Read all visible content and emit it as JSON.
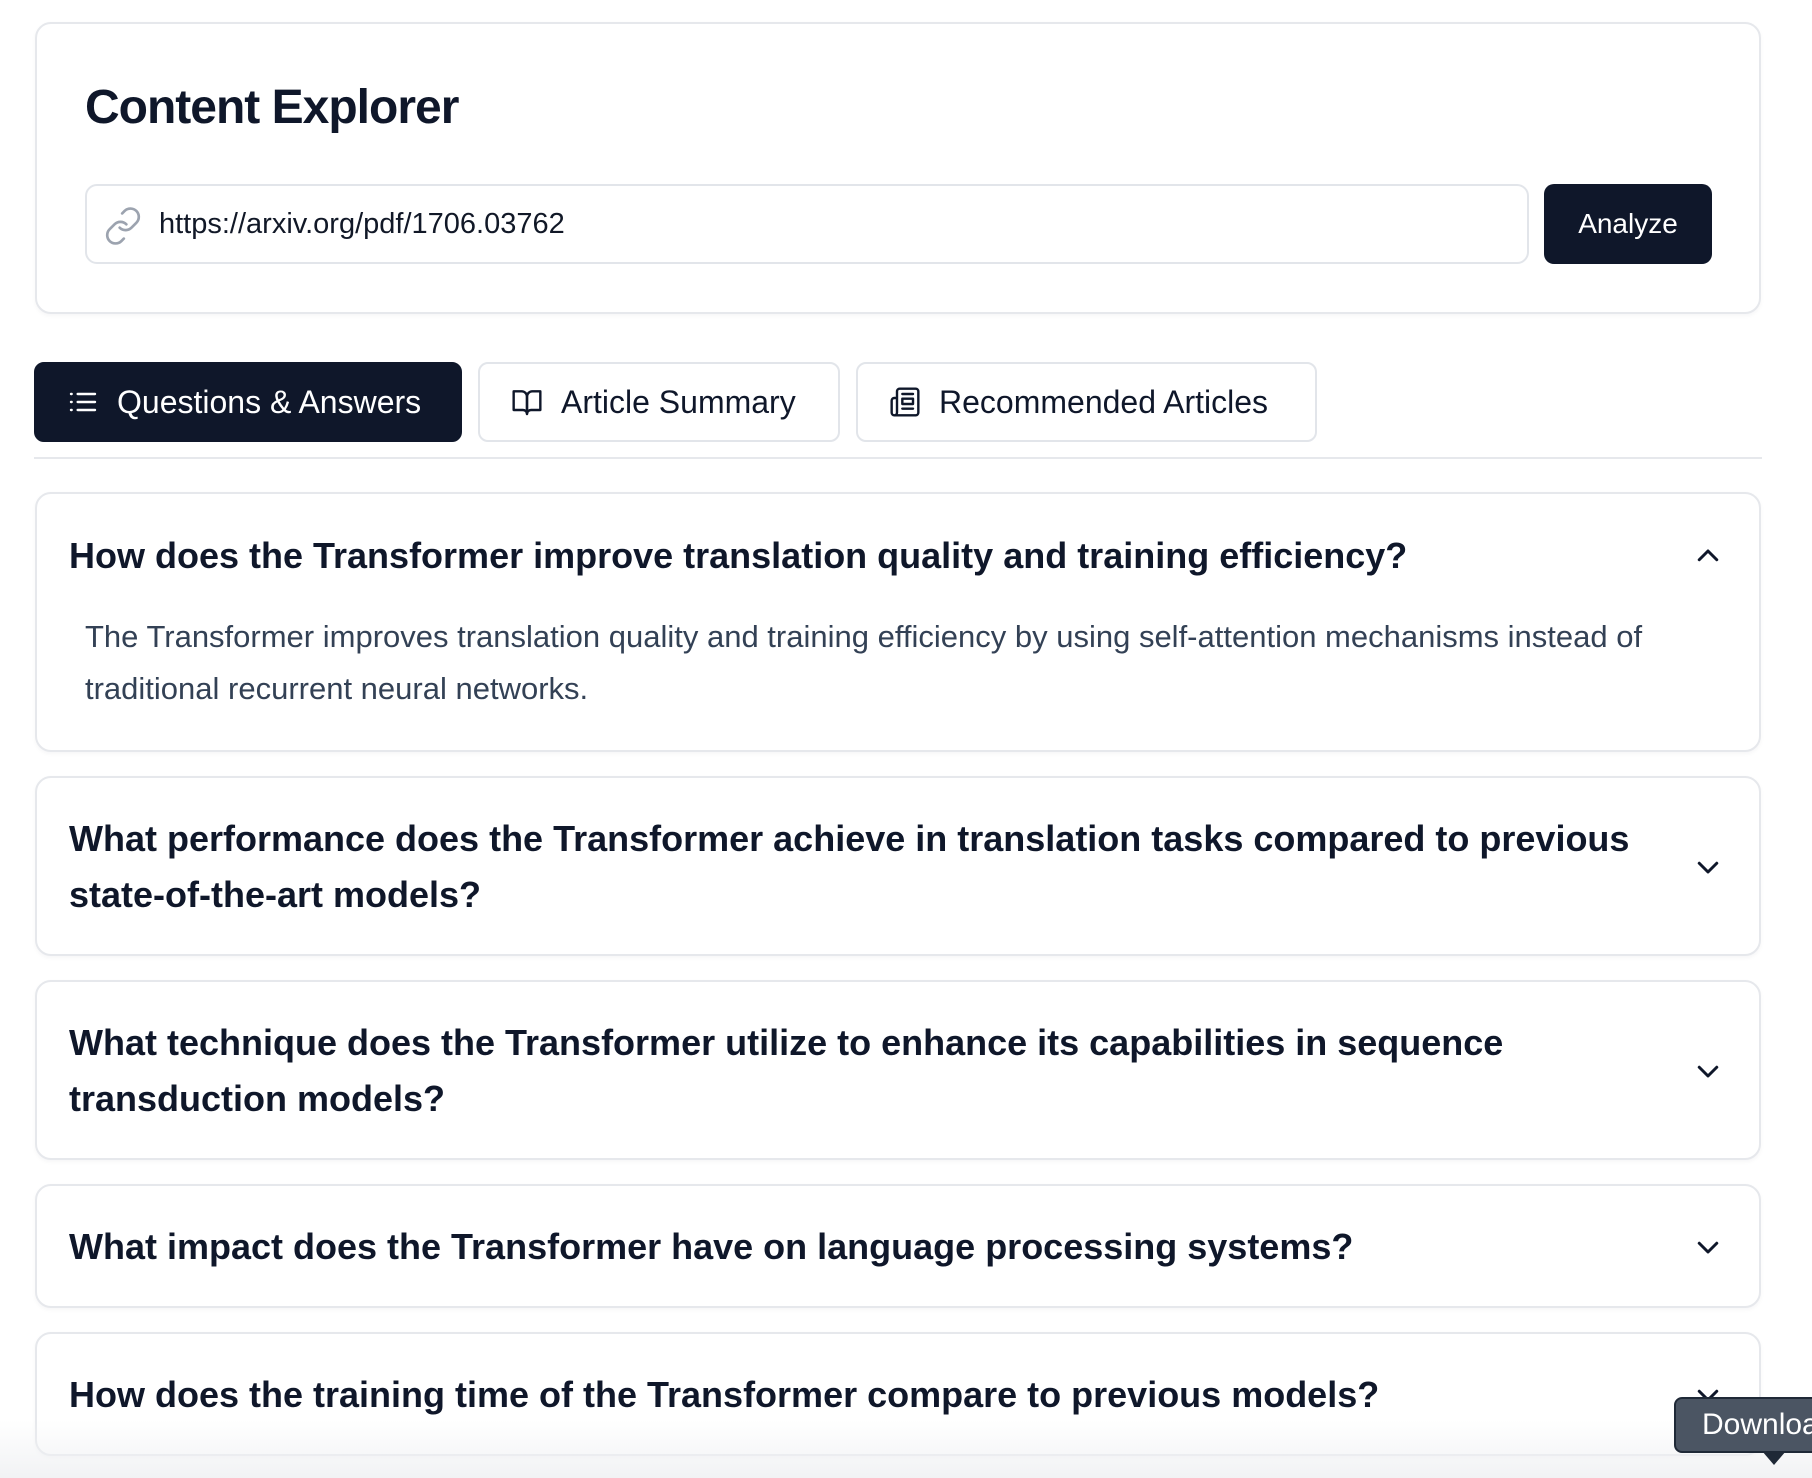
{
  "app": {
    "title": "Content Explorer"
  },
  "url_bar": {
    "value": "https://arxiv.org/pdf/1706.03762",
    "icon": "link-icon",
    "analyze_label": "Analyze"
  },
  "tabs": [
    {
      "label": "Questions & Answers",
      "icon": "list-icon",
      "active": true
    },
    {
      "label": "Article Summary",
      "icon": "book-open-icon",
      "active": false
    },
    {
      "label": "Recommended Articles",
      "icon": "newspaper-icon",
      "active": false
    }
  ],
  "qa": [
    {
      "question": "How does the Transformer improve translation quality and training efficiency?",
      "answer": "The Transformer improves translation quality and training efficiency by using self-attention mechanisms instead of traditional recurrent neural networks.",
      "expanded": true
    },
    {
      "question": "What performance does the Transformer achieve in translation tasks compared to previous state-of-the-art models?",
      "expanded": false
    },
    {
      "question": "What technique does the Transformer utilize to enhance its capabilities in sequence transduction models?",
      "expanded": false
    },
    {
      "question": "What impact does the Transformer have on language processing systems?",
      "expanded": false
    },
    {
      "question": "How does the training time of the Transformer compare to previous models?",
      "expanded": false
    }
  ],
  "tooltip": {
    "label": "Download"
  },
  "colors": {
    "primary": "#0f172a",
    "border": "#e2e5ea",
    "answer_text": "#334155"
  }
}
